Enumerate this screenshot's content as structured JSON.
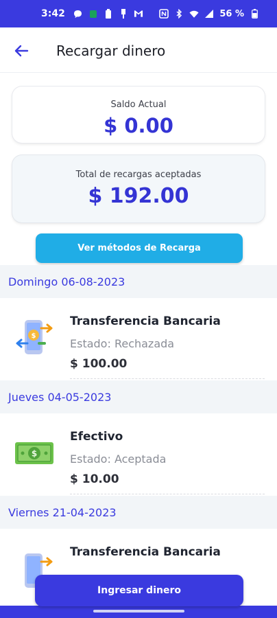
{
  "status_bar": {
    "time": "3:42",
    "battery_pct": "56 %",
    "left_icons": [
      "chat-bubble-icon",
      "messages-icon",
      "battery-saver-icon",
      "usb-icon",
      "gmail-icon"
    ],
    "right_icons": [
      "nfc-icon",
      "bluetooth-icon",
      "wifi-icon",
      "signal-icon",
      "battery-icon"
    ],
    "color": "#3a3adf"
  },
  "appbar": {
    "title": "Recargar dinero",
    "back_icon": "arrow-left-icon"
  },
  "balance_card": {
    "label": "Saldo Actual",
    "amount": "$ 0.00"
  },
  "total_card": {
    "label": "Total de recargas aceptadas",
    "amount": "$ 192.00"
  },
  "methods_button": {
    "label": "Ver métodos de Recarga",
    "color": "#20ade6"
  },
  "transactions": [
    {
      "date": "Domingo 06-08-2023",
      "title": "Transferencia Bancaria",
      "status": "Estado: Rechazada",
      "amount": "$ 100.00",
      "icon": "bank-transfer-phone-icon"
    },
    {
      "date": "Jueves 04-05-2023",
      "title": "Efectivo",
      "status": "Estado: Aceptada",
      "amount": "$ 10.00",
      "icon": "cash-bill-icon"
    },
    {
      "date": "Viernes 21-04-2023",
      "title": "Transferencia Bancaria",
      "status": "",
      "amount": "",
      "icon": "bank-transfer-phone-icon"
    }
  ],
  "ingresar_button": {
    "label": "Ingresar dinero",
    "color": "#3a3adf"
  },
  "colors": {
    "primary": "#3a3adf",
    "amount_blue": "#3434d4",
    "date_header_bg": "#f2f5f8"
  }
}
